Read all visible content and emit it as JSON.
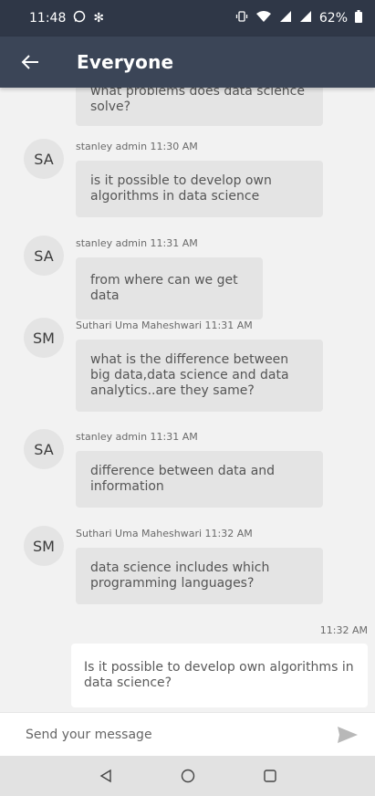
{
  "status_bar": {
    "time": "11:48",
    "left_icons": [
      "whatsapp-icon",
      "snowflake-icon"
    ],
    "right_icons": [
      "vibrate-icon",
      "wifi-icon",
      "signal-icon",
      "signal-icon"
    ],
    "battery_text": "62%"
  },
  "app_bar": {
    "title": "Everyone"
  },
  "colors": {
    "status_bar_bg": "#2f3747",
    "app_bar_bg": "#3b4557",
    "chat_bg": "#f2f2f2",
    "incoming_bubble": "#e4e4e4",
    "outgoing_bubble": "#ffffff"
  },
  "messages": [
    {
      "text": "what problems does data science solve?"
    },
    {
      "avatar": "SA",
      "meta": "stanley admin 11:30 AM",
      "text": "is it possible to develop own algorithms in data science"
    },
    {
      "avatar": "SA",
      "meta": "stanley admin 11:31 AM",
      "text": "from where can we get data"
    },
    {
      "avatar": "SM",
      "meta": "Suthari Uma Maheshwari 11:31 AM",
      "text": "what is the difference between big data,data science and data analytics..are they same?"
    },
    {
      "avatar": "SA",
      "meta": "stanley admin 11:31 AM",
      "text": "difference between data and information"
    },
    {
      "avatar": "SM",
      "meta": "Suthari Uma Maheshwari 11:32 AM",
      "text": "data science includes which programming languages?"
    }
  ],
  "outgoing": {
    "time": "11:32 AM",
    "text": "Is it possible to develop own algorithms in data science?"
  },
  "composer": {
    "placeholder": "Send your message"
  },
  "nav": {
    "icons": [
      "back-triangle-icon",
      "home-circle-icon",
      "recents-square-icon"
    ]
  }
}
